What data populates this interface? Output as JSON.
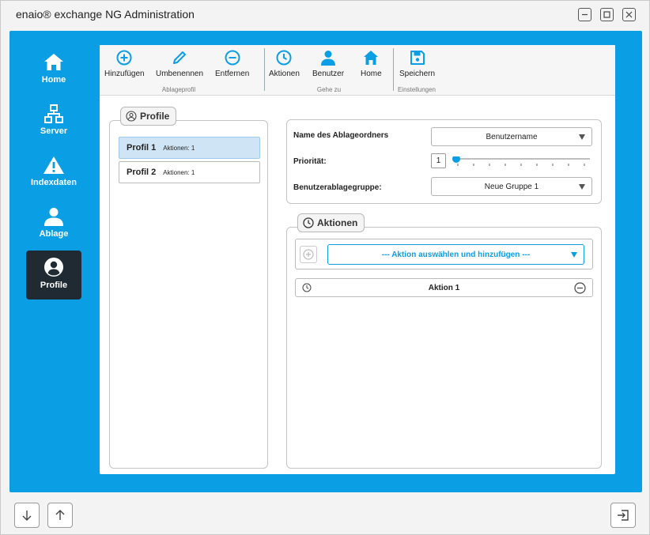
{
  "window": {
    "title": "enaio® exchange NG Administration"
  },
  "colors": {
    "accent": "#0a9fe5",
    "nav_active": "#1f2a33",
    "selected_row": "#cfe5f6"
  },
  "nav": [
    {
      "label": "Home",
      "icon": "home-icon"
    },
    {
      "label": "Server",
      "icon": "network-icon"
    },
    {
      "label": "Indexdaten",
      "icon": "warning-icon"
    },
    {
      "label": "Ablage",
      "icon": "user-icon"
    },
    {
      "label": "Profile",
      "icon": "profile-icon",
      "active": true
    }
  ],
  "ribbon": {
    "buttons": [
      {
        "label": "Hinzufügen",
        "icon": "plus-circle-icon"
      },
      {
        "label": "Umbenennen",
        "icon": "pencil-icon"
      },
      {
        "label": "Entfernen",
        "icon": "minus-circle-icon"
      },
      {
        "label": "Aktionen",
        "icon": "clock-icon"
      },
      {
        "label": "Benutzer",
        "icon": "user-icon"
      },
      {
        "label": "Home",
        "icon": "home-icon"
      },
      {
        "label": "Speichern",
        "icon": "save-icon"
      }
    ],
    "groups": [
      "Ablageprofil",
      "Gehe zu",
      "Einstellungen"
    ]
  },
  "profiles": {
    "legend": "Profile",
    "items": [
      {
        "name": "Profil 1",
        "actions": "Aktionen: 1",
        "selected": true
      },
      {
        "name": "Profil 2",
        "actions": "Aktionen: 1",
        "selected": false
      }
    ]
  },
  "settings": {
    "folder_name_label": "Name des Ablageordners",
    "folder_name_value": "Benutzername",
    "priority_label": "Priorität:",
    "priority_value": "1",
    "group_label": "Benutzerablagegruppe:",
    "group_value": "Neue Gruppe 1"
  },
  "actions": {
    "legend": "Aktionen",
    "select_placeholder": "--- Aktion auswählen und hinzufügen ---",
    "items": [
      {
        "label": "Aktion 1"
      }
    ]
  }
}
